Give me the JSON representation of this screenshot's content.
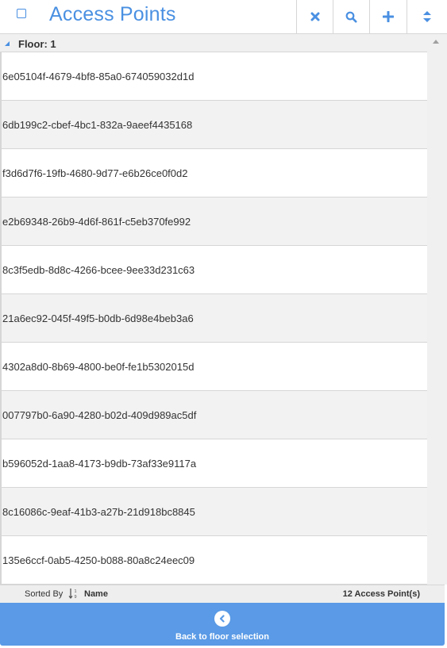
{
  "header": {
    "title": "Access Points",
    "buttons": [
      {
        "icon": "close-icon"
      },
      {
        "icon": "search-icon"
      },
      {
        "icon": "plus-icon"
      },
      {
        "icon": "sort-icon"
      }
    ]
  },
  "group": {
    "label": "Floor: 1"
  },
  "items": [
    "6e05104f-4679-4bf8-85a0-674059032d1d",
    "6db199c2-cbef-4bc1-832a-9aeef4435168",
    "f3d6d7f6-19fb-4680-9d77-e6b26ce0f0d2",
    "e2b69348-26b9-4d6f-861f-c5eb370fe992",
    "8c3f5edb-8d8c-4266-bcee-9ee33d231c63",
    "21a6ec92-045f-49f5-b0db-6d98e4beb3a6",
    "4302a8d0-8b69-4800-be0f-fe1b5302015d",
    "007797b0-6a90-4280-b02d-409d989ac5df",
    "b596052d-1aa8-4173-b9db-73af33e9117a",
    "8c16086c-9eaf-41b3-a27b-21d918bc8845",
    "135e6ccf-0ab5-4250-b088-80a8c24eec09"
  ],
  "footer": {
    "sorted_by_label": "Sorted By",
    "sort_field": "Name",
    "count_label": "12 Access Point(s)"
  },
  "back_button": {
    "label": "Back to floor selection"
  },
  "colors": {
    "accent": "#4a90e2",
    "back_button_bg": "#5a9ae6",
    "row_alt": "#f2f2f2",
    "border": "#d6d6d6"
  }
}
